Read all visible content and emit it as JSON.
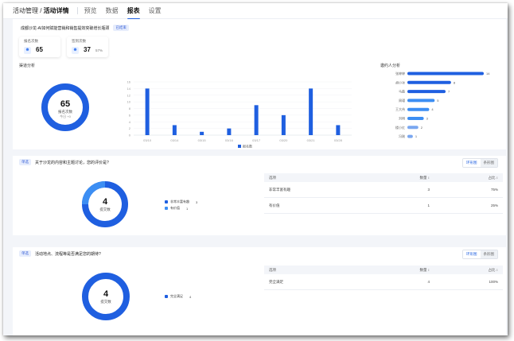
{
  "header": {
    "breadcrumb_parent": "活动管理",
    "breadcrumb_sep": " / ",
    "breadcrumb_current": "活动详情",
    "tabs": [
      "预览",
      "数据",
      "报表",
      "设置"
    ],
    "active_tab": "报表"
  },
  "event": {
    "title": "成都沙龙-AI如何赋能营销和销售提效突破增长瓶颈",
    "status": "已结束"
  },
  "stats": [
    {
      "label": "报名次数",
      "value": "65",
      "percent": "",
      "icon": "user-icon"
    },
    {
      "label": "签到次数",
      "value": "37",
      "percent": "57%",
      "icon": "user-check-icon"
    }
  ],
  "channel": {
    "label": "渠道分析",
    "donut_value": "65",
    "donut_label": "报名次数",
    "donut_sub": "今日 +0"
  },
  "referrer": {
    "label": "邀约人分析"
  },
  "colors": {
    "primary": "#1f5fe0",
    "secondary": "#3c8ef3",
    "light_bar": "#7aa7f0"
  },
  "chart_data": [
    {
      "type": "bar",
      "categories": [
        "03/10",
        "03/14",
        "03/15",
        "03/16",
        "03/17",
        "03/20",
        "03/21",
        "03/28"
      ],
      "series": [
        {
          "name": "报名数",
          "values": [
            14,
            3,
            1,
            2,
            9,
            6,
            14,
            3
          ]
        }
      ],
      "ylim": [
        0,
        16
      ],
      "yticks": [
        0,
        2,
        4,
        6,
        8,
        10,
        12,
        14,
        16
      ],
      "legend": "bottom-center"
    },
    {
      "type": "bar",
      "orientation": "horizontal",
      "categories": [
        "张婷婷",
        "胡小冰",
        "马磊",
        "周瑾",
        "王大伟",
        "刘明",
        "楼小红",
        "冯刚"
      ],
      "values": [
        14,
        8,
        7,
        5,
        4,
        3,
        2,
        1
      ]
    }
  ],
  "questions": [
    {
      "tag": "单选",
      "text": "关于沙龙的内容和主题讨论，您的评价是?",
      "toggle": [
        "环形图",
        "条形图"
      ],
      "donut_value": "4",
      "donut_label": "提交数",
      "legend": [
        {
          "label": "非常丰富有趣",
          "value": "3"
        },
        {
          "label": "有价值",
          "value": "1"
        }
      ],
      "table_header": [
        "选项",
        "数量 ↕",
        "占比 ↕"
      ],
      "rows": [
        {
          "option": "非常丰富有趣",
          "count": "3",
          "pct": "75%"
        },
        {
          "option": "有价值",
          "count": "1",
          "pct": "25%"
        }
      ]
    },
    {
      "tag": "单选",
      "text": "活动地点、流程等是否满足您的期待?",
      "toggle": [
        "环形图",
        "条形图"
      ],
      "donut_value": "4",
      "donut_label": "提交数",
      "legend": [
        {
          "label": "完全满足",
          "value": "4"
        }
      ],
      "table_header": [
        "选项",
        "数量 ↕",
        "占比 ↕"
      ],
      "rows": [
        {
          "option": "完全满足",
          "count": "4",
          "pct": "100%"
        }
      ]
    }
  ]
}
